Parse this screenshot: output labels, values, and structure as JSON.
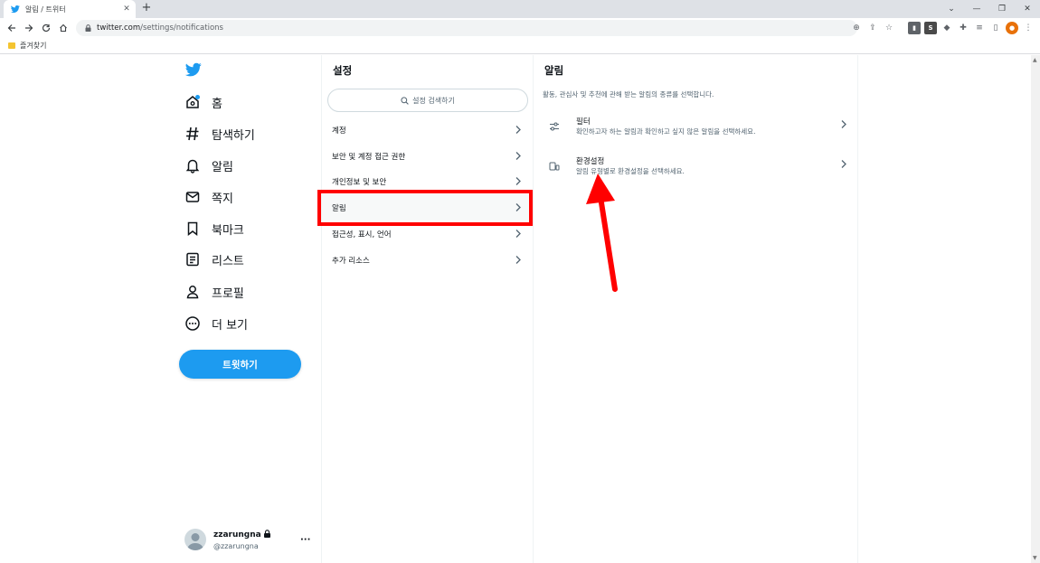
{
  "browser": {
    "tab_title": "알림 / 트위터",
    "url_host": "twitter.com",
    "url_path": "/settings/notifications",
    "bookmarks_label": "즐겨찾기",
    "new_tab_label": "+",
    "tab_close_label": "✕"
  },
  "sidenav": {
    "items": [
      {
        "label": "홈",
        "icon": "home-icon"
      },
      {
        "label": "탐색하기",
        "icon": "hashtag-icon"
      },
      {
        "label": "알림",
        "icon": "bell-icon"
      },
      {
        "label": "쪽지",
        "icon": "envelope-icon"
      },
      {
        "label": "북마크",
        "icon": "bookmark-icon"
      },
      {
        "label": "리스트",
        "icon": "list-icon"
      },
      {
        "label": "프로필",
        "icon": "person-icon"
      },
      {
        "label": "더 보기",
        "icon": "more-circle-icon"
      }
    ],
    "tweet_button": "트윗하기",
    "account": {
      "name": "zzarungna",
      "handle": "@zzarungna",
      "more": "···"
    }
  },
  "settings": {
    "title": "설정",
    "search_placeholder": "설정 검색하기",
    "items": [
      {
        "label": "계정"
      },
      {
        "label": "보안 및 계정 접근 권한"
      },
      {
        "label": "개인정보 및 보안"
      },
      {
        "label": "알림",
        "active": true
      },
      {
        "label": "접근성, 표시, 언어"
      },
      {
        "label": "추가 리소스"
      }
    ]
  },
  "detail": {
    "title": "알림",
    "description": "활동, 관심사 및 추천에 관해 받는 알림의 종류를 선택합니다.",
    "items": [
      {
        "label": "필터",
        "sub": "확인하고자 하는 알림과 확인하고 싶지 않은 알림을 선택하세요.",
        "icon": "sliders-icon"
      },
      {
        "label": "환경설정",
        "sub": "알림 유형별로 환경설정을 선택하세요.",
        "icon": "devices-icon"
      }
    ]
  },
  "colors": {
    "brand": "#1d9bf0",
    "annotation": "#ff0000"
  }
}
